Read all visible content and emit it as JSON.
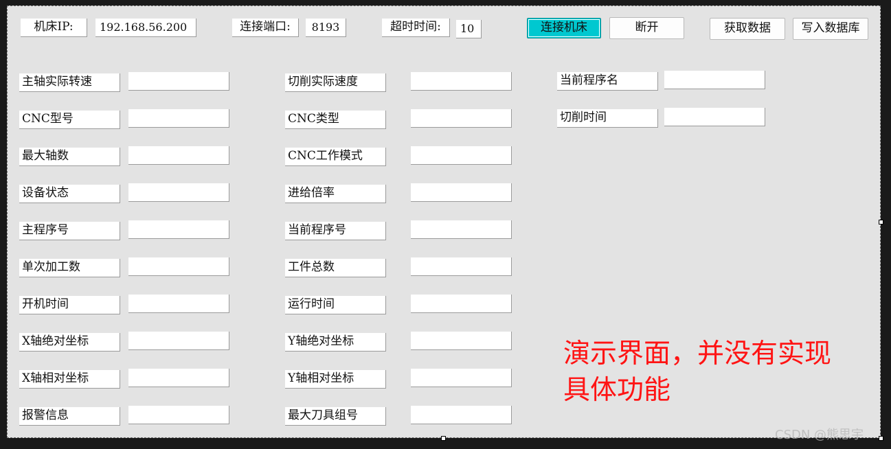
{
  "connection": {
    "ip_label": "机床IP:",
    "ip_value": "192.168.56.200",
    "port_label": "连接端口:",
    "port_value": "8193",
    "timeout_label": "超时时间:",
    "timeout_value": "10"
  },
  "buttons": {
    "connect": "连接机床",
    "disconnect": "断开",
    "fetch": "获取数据",
    "write_db": "写入数据库"
  },
  "fields_col1": [
    {
      "label": "主轴实际转速",
      "value": ""
    },
    {
      "label": "CNC型号",
      "value": ""
    },
    {
      "label": "最大轴数",
      "value": ""
    },
    {
      "label": "设备状态",
      "value": ""
    },
    {
      "label": "主程序号",
      "value": ""
    },
    {
      "label": "单次加工数",
      "value": ""
    },
    {
      "label": "开机时间",
      "value": ""
    },
    {
      "label": "X轴绝对坐标",
      "value": ""
    },
    {
      "label": "X轴相对坐标",
      "value": ""
    },
    {
      "label": "报警信息",
      "value": ""
    }
  ],
  "fields_col2": [
    {
      "label": "切削实际速度",
      "value": ""
    },
    {
      "label": "CNC类型",
      "value": ""
    },
    {
      "label": "CNC工作模式",
      "value": ""
    },
    {
      "label": "进给倍率",
      "value": ""
    },
    {
      "label": "当前程序号",
      "value": ""
    },
    {
      "label": "工件总数",
      "value": ""
    },
    {
      "label": "运行时间",
      "value": ""
    },
    {
      "label": "Y轴绝对坐标",
      "value": ""
    },
    {
      "label": "Y轴相对坐标",
      "value": ""
    },
    {
      "label": "最大刀具组号",
      "value": ""
    }
  ],
  "fields_col3": [
    {
      "label": "当前程序名",
      "value": ""
    },
    {
      "label": "切削时间",
      "value": ""
    }
  ],
  "annotation": {
    "line1": "演示界面，并没有实现",
    "line2": "具体功能"
  },
  "watermark": "CSDN @熊思宇",
  "colors": {
    "form_bg": "#e3e3e3",
    "connect_active": "#00c8d0",
    "annotation": "#ff1414"
  }
}
